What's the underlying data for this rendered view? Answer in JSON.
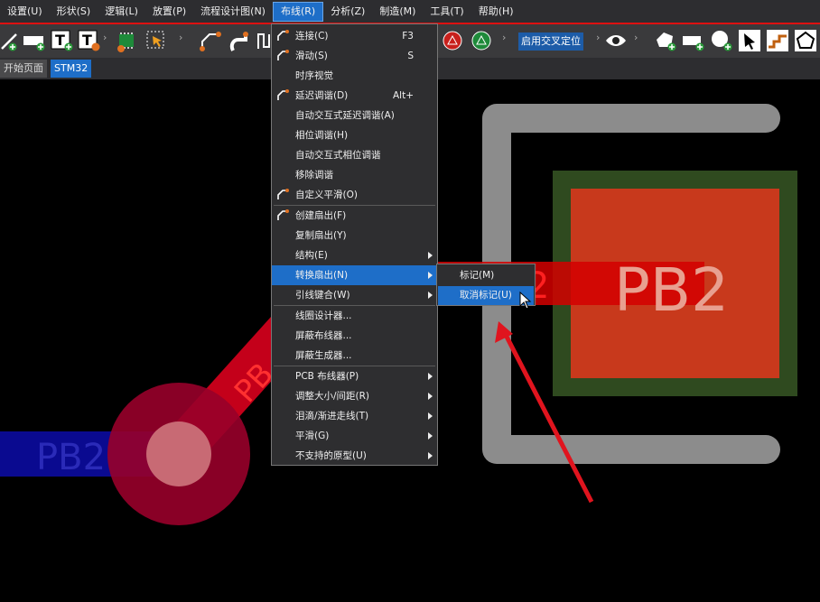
{
  "menubar": [
    "设置(U)",
    "形状(S)",
    "逻辑(L)",
    "放置(P)",
    "流程设计图(N)",
    "布线(R)",
    "分析(Z)",
    "制造(M)",
    "工具(T)",
    "帮助(H)"
  ],
  "toolbar": {
    "mode_label": "启用交叉定位"
  },
  "tabs": [
    "开始页面",
    "STM32"
  ],
  "dropdown": {
    "items": [
      {
        "label": "连接(C)",
        "shortcut": "F3"
      },
      {
        "label": "滑动(S)",
        "shortcut": "S"
      },
      {
        "label": "时序视觉",
        "shortcut": ""
      },
      {
        "label": "延迟调谐(D)",
        "shortcut": "Alt+"
      },
      {
        "label": "自动交互式延迟调谐(A)",
        "shortcut": ""
      },
      {
        "label": "相位调谐(H)",
        "shortcut": ""
      },
      {
        "label": "自动交互式相位调谐",
        "shortcut": ""
      },
      {
        "label": "移除调谐",
        "shortcut": ""
      },
      {
        "label": "自定义平滑(O)",
        "shortcut": ""
      },
      {
        "label": "创建扇出(F)",
        "shortcut": ""
      },
      {
        "label": "复制扇出(Y)",
        "shortcut": ""
      },
      {
        "label": "结构(E)",
        "shortcut": ""
      },
      {
        "label": "转换扇出(N)",
        "shortcut": ""
      },
      {
        "label": "引线键合(W)",
        "shortcut": ""
      },
      {
        "label": "线圈设计器...",
        "shortcut": ""
      },
      {
        "label": "屏蔽布线器...",
        "shortcut": ""
      },
      {
        "label": "屏蔽生成器...",
        "shortcut": ""
      },
      {
        "label": "PCB 布线器(P)",
        "shortcut": ""
      },
      {
        "label": "调整大小/间距(R)",
        "shortcut": ""
      },
      {
        "label": "泪滴/渐进走线(T)",
        "shortcut": ""
      },
      {
        "label": "平滑(G)",
        "shortcut": ""
      },
      {
        "label": "不支持的原型(U)",
        "shortcut": ""
      }
    ]
  },
  "submenu": {
    "items": [
      "标记(M)",
      "取消标记(U)"
    ]
  },
  "canvas": {
    "pad_label": "PB2",
    "pad_label_overlap": "2",
    "net_label_blue": "PB2",
    "net_label_trace": "PB"
  },
  "colors": {
    "accent": "#1e6ec8",
    "menu_border": "#dd1111",
    "pad_red": "#c8391c",
    "pad_green": "#2f4a1f",
    "trace_gray": "#8c8c8c",
    "arrow_red": "#e0141e"
  }
}
